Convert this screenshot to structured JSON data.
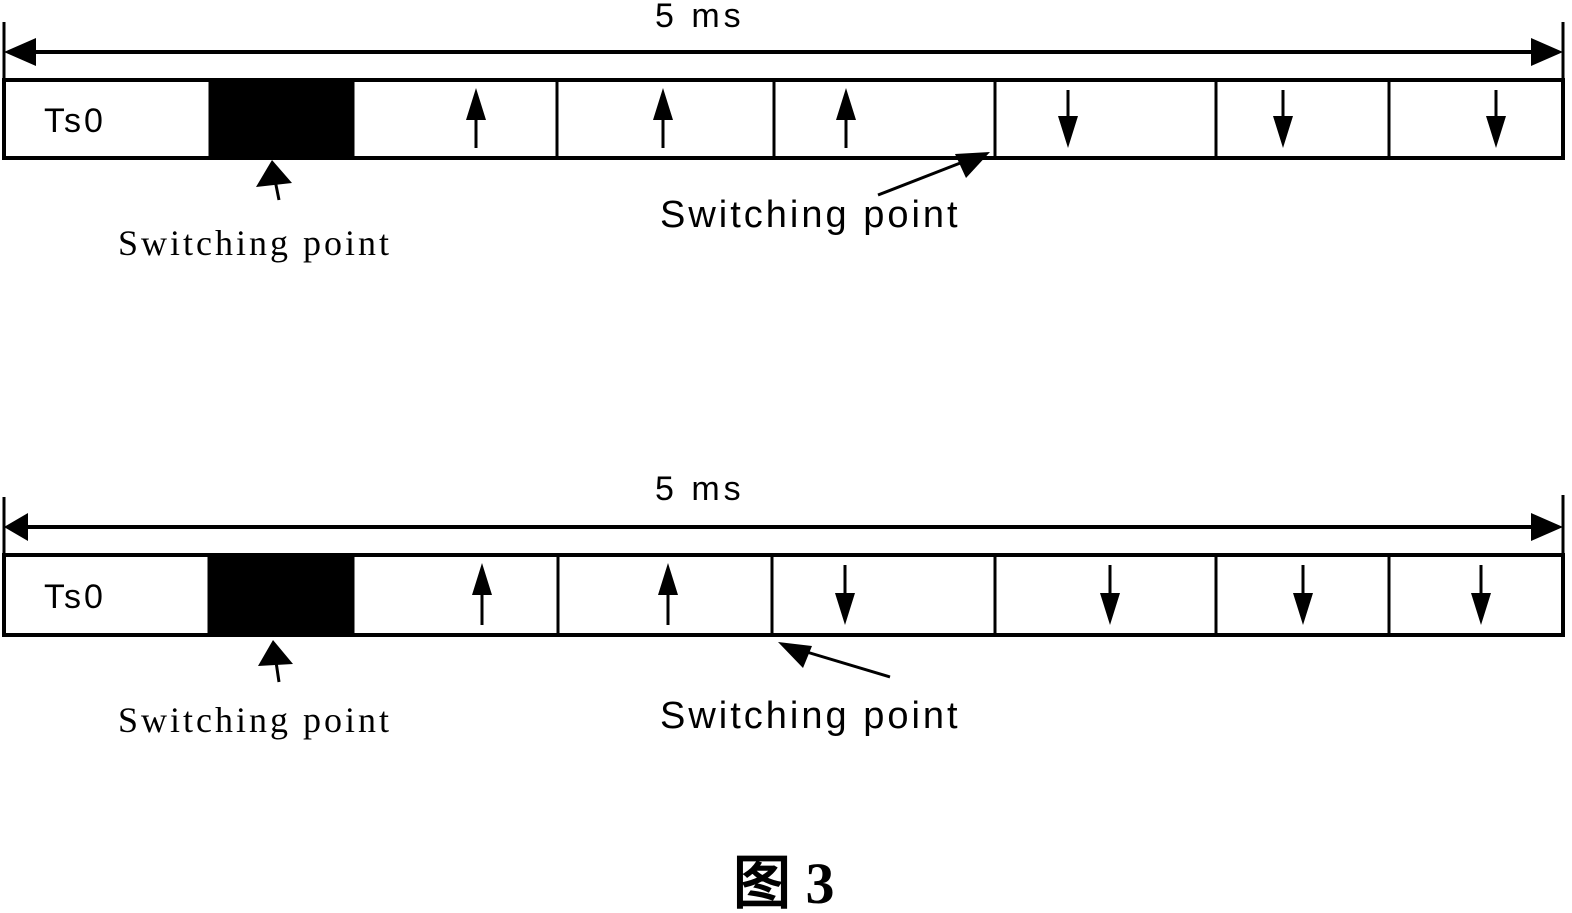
{
  "figure": {
    "caption": "图 3",
    "frames": [
      {
        "id": "frame-1",
        "duration_label": "5 ms",
        "slots": [
          {
            "label": "Ts0",
            "type": "ts0"
          },
          {
            "label": "",
            "type": "guard"
          },
          {
            "label": "",
            "type": "uplink",
            "direction": "up"
          },
          {
            "label": "",
            "type": "uplink",
            "direction": "up"
          },
          {
            "label": "",
            "type": "uplink",
            "direction": "up"
          },
          {
            "label": "",
            "type": "downlink",
            "direction": "down"
          },
          {
            "label": "",
            "type": "downlink",
            "direction": "down"
          },
          {
            "label": "",
            "type": "downlink",
            "direction": "down"
          }
        ],
        "switching_points": [
          {
            "label": "Switching point",
            "position": "guard period (after Ts0)"
          },
          {
            "label": "Switching point",
            "position": "between uplink slot 3 and downlink slot 4"
          }
        ]
      },
      {
        "id": "frame-2",
        "duration_label": "5 ms",
        "slots": [
          {
            "label": "Ts0",
            "type": "ts0"
          },
          {
            "label": "",
            "type": "guard"
          },
          {
            "label": "",
            "type": "uplink",
            "direction": "up"
          },
          {
            "label": "",
            "type": "uplink",
            "direction": "up"
          },
          {
            "label": "",
            "type": "downlink",
            "direction": "down"
          },
          {
            "label": "",
            "type": "downlink",
            "direction": "down"
          },
          {
            "label": "",
            "type": "downlink",
            "direction": "down"
          },
          {
            "label": "",
            "type": "downlink",
            "direction": "down"
          }
        ],
        "switching_points": [
          {
            "label": "Switching point",
            "position": "guard period (after Ts0)"
          },
          {
            "label": "Switching point",
            "position": "between uplink slot 2 and downlink slot 3"
          }
        ]
      }
    ]
  }
}
